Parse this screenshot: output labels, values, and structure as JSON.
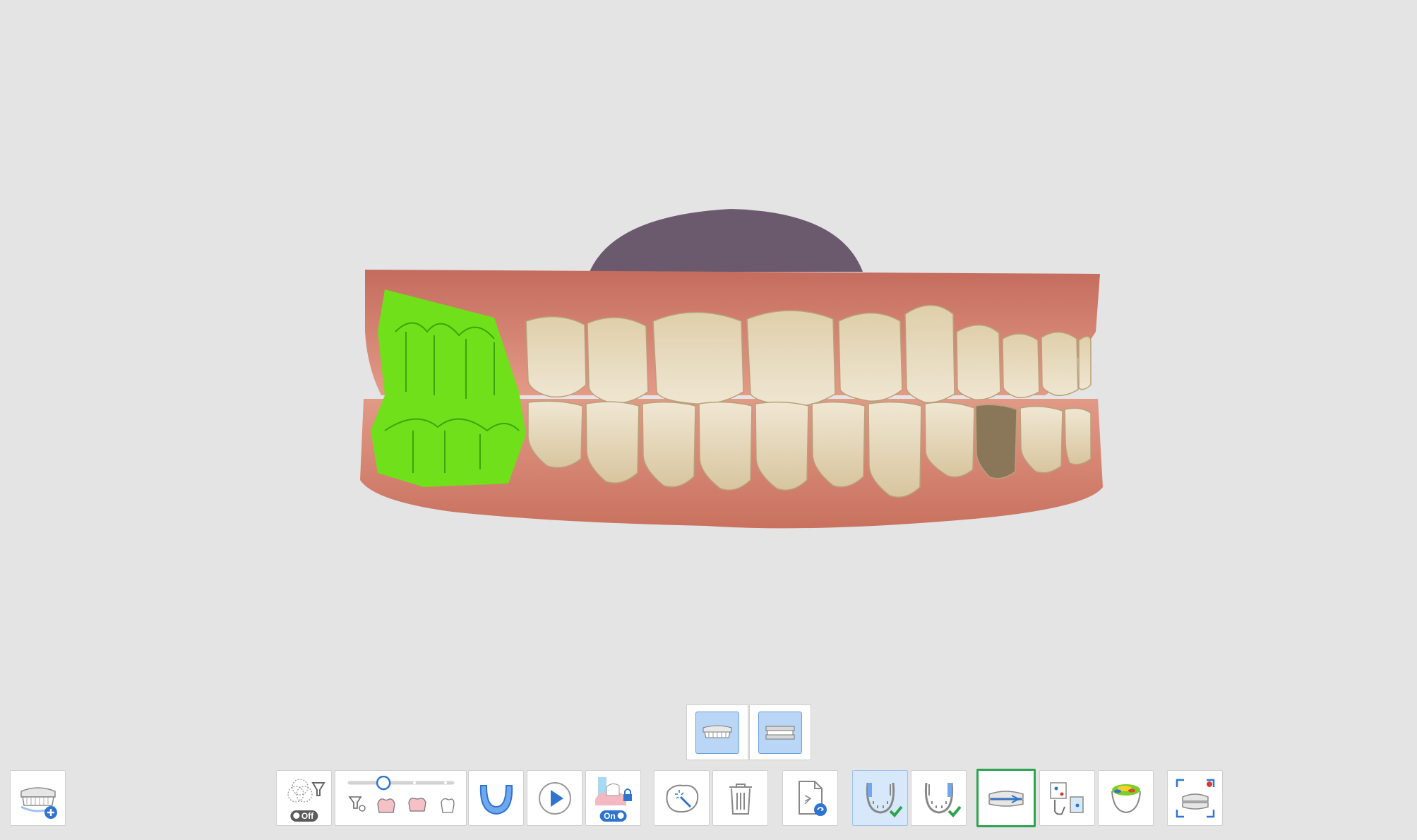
{
  "viewport": {
    "scene": "3d-dental-scan-occlusion"
  },
  "colors": {
    "selection_green": "#2ea44f",
    "active_blue": "#2f74d0",
    "highlight_green": "#6fe01a",
    "background": "#e4e4e4"
  },
  "toolbar": {
    "filter_toggle": {
      "icon": "filter-overlap-icon",
      "state": "Off"
    },
    "slider": {
      "icon": "filter-level-slider",
      "value": 0.33
    },
    "lock_toggle": {
      "icon": "lock-margin-icon",
      "state": "On"
    },
    "tools": [
      "add-scan-icon",
      "arch-icon",
      "play-icon",
      "magic-wand-icon",
      "trash-icon",
      "export-file-icon",
      "upper-arch-check-icon",
      "lower-arch-check-icon",
      "bite-align-icon",
      "point-align-icon",
      "heatmap-icon",
      "fit-view-icon"
    ]
  },
  "view_switch": {
    "options": [
      "upper-jaw-view-icon",
      "occlusion-view-icon"
    ]
  }
}
